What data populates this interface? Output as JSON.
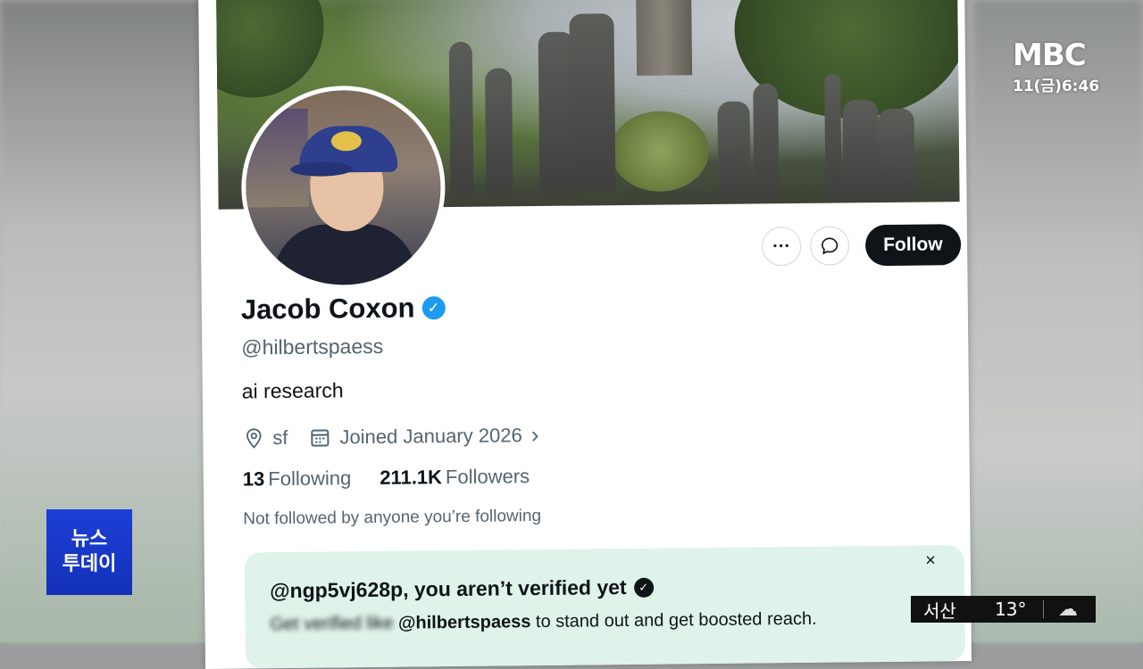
{
  "broadcast": {
    "logo": "MBC",
    "time": "11(금)6:46",
    "program_line1": "뉴스",
    "program_line2": "투데이",
    "weather_city": "서산",
    "weather_temp": "13°",
    "weather_icon": "cloud-icon"
  },
  "profile": {
    "name": "Jacob Coxon",
    "handle": "@hilbertspaess",
    "bio": "ai research",
    "location": "sf",
    "joined": "Joined January 2026",
    "following_count": "13",
    "following_label": "Following",
    "followers_count": "211.1K",
    "followers_label": "Followers",
    "not_followed": "Not followed by anyone you’re following"
  },
  "actions": {
    "more_label": "···",
    "follow_label": "Follow"
  },
  "verify_card": {
    "title": "@ngp5vj628p, you aren’t verified yet",
    "sub_blurred": "Get verified like",
    "sub_handle": "@hilbertspaess",
    "sub_rest": "to stand out and get boosted reach.",
    "close": "×"
  },
  "colors": {
    "accent_blue": "#1d9bf0",
    "follow_bg": "#0f1419",
    "card_bg": "#dff3ea",
    "news_blue": "#1d3fd6"
  }
}
